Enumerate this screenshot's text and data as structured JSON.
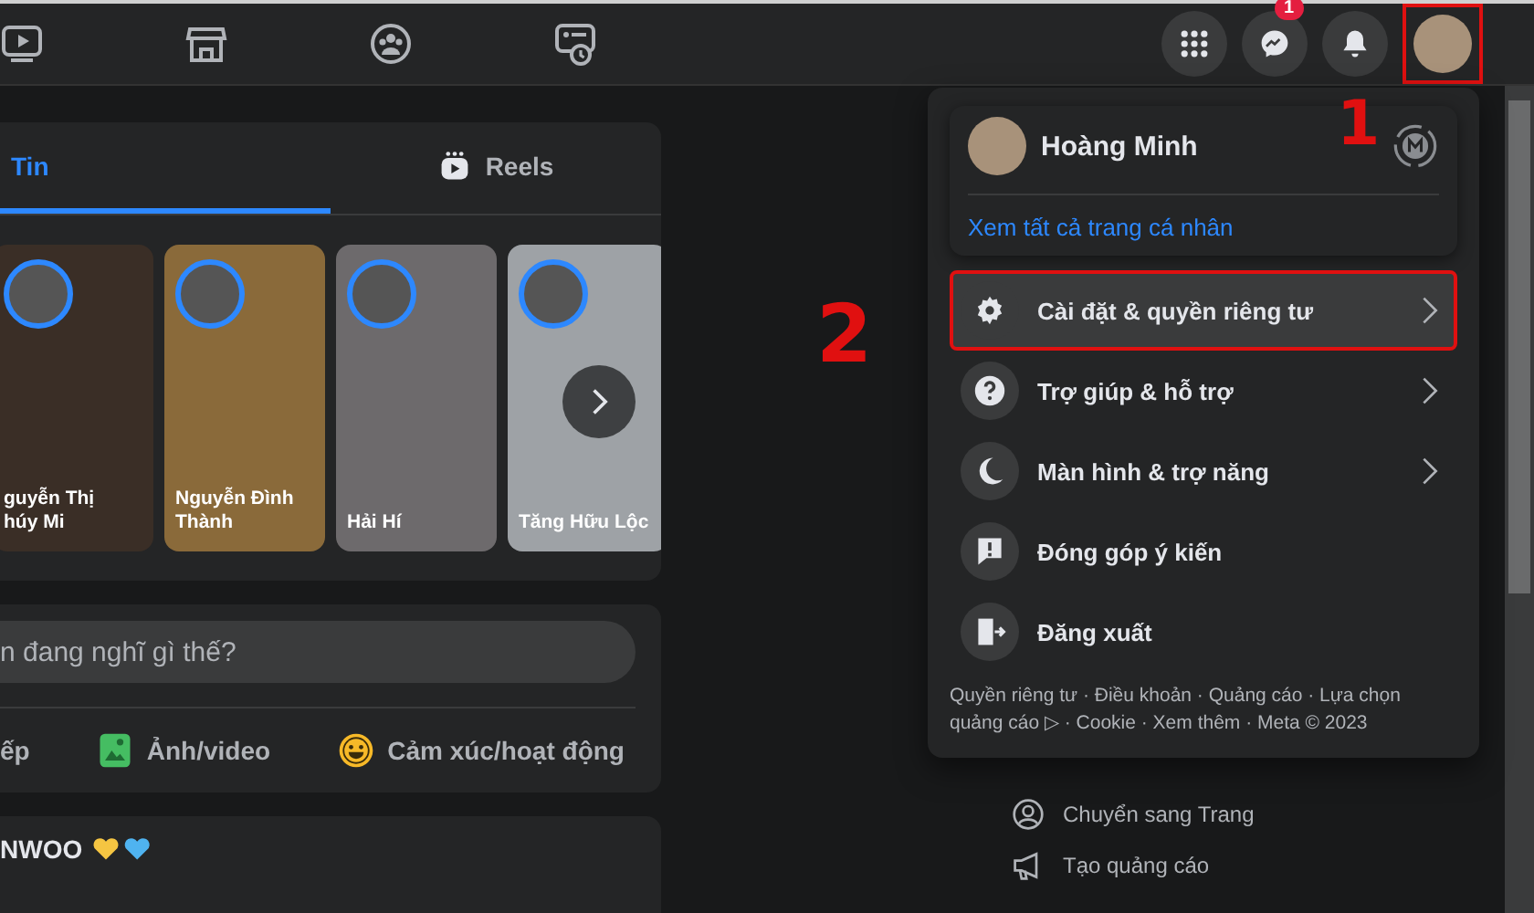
{
  "top_bar": {
    "notification_badge": "1",
    "avatar_highlighted": true
  },
  "stories_card": {
    "tabs": [
      {
        "label": "Tin",
        "selected": true
      },
      {
        "label": "Reels",
        "selected": false
      }
    ],
    "stories": [
      {
        "name": "guyễn Thị\nhúy Mi"
      },
      {
        "name": "Nguyễn Đình\nThành"
      },
      {
        "name": "Hải Hí"
      },
      {
        "name": "Tăng Hữu Lộc"
      }
    ]
  },
  "composer": {
    "placeholder": "n đang nghĩ gì thế?",
    "actions": [
      {
        "kind": "live",
        "label": "ếp"
      },
      {
        "kind": "photo",
        "label": "Ảnh/video"
      },
      {
        "kind": "feeling",
        "label": "Cảm xúc/hoạt động"
      }
    ]
  },
  "post": {
    "author": "NWOO"
  },
  "account_menu": {
    "profile_name": "Hoàng Minh",
    "profile_link": "Xem tất cả trang cá nhân",
    "items": [
      {
        "kind": "settings",
        "label": "Cài đặt & quyền riêng tư",
        "submenu": true,
        "highlighted": true
      },
      {
        "kind": "help",
        "label": "Trợ giúp & hỗ trợ",
        "submenu": true,
        "highlighted": false
      },
      {
        "kind": "display",
        "label": "Màn hình & trợ năng",
        "submenu": true,
        "highlighted": false
      },
      {
        "kind": "feedback",
        "label": "Đóng góp ý kiến",
        "submenu": false,
        "highlighted": false
      },
      {
        "kind": "logout",
        "label": "Đăng xuất",
        "submenu": false,
        "highlighted": false
      }
    ],
    "footer": "Quyền riêng tư · Điều khoản · Quảng cáo · Lựa chọn quảng cáo ▷ · Cookie · Xem thêm · Meta © 2023"
  },
  "shortcuts": [
    {
      "kind": "page",
      "label": "Chuyển sang Trang"
    },
    {
      "kind": "ad",
      "label": "Tạo quảng cáo"
    }
  ],
  "annotations": [
    {
      "label": "1"
    },
    {
      "label": "2"
    }
  ]
}
